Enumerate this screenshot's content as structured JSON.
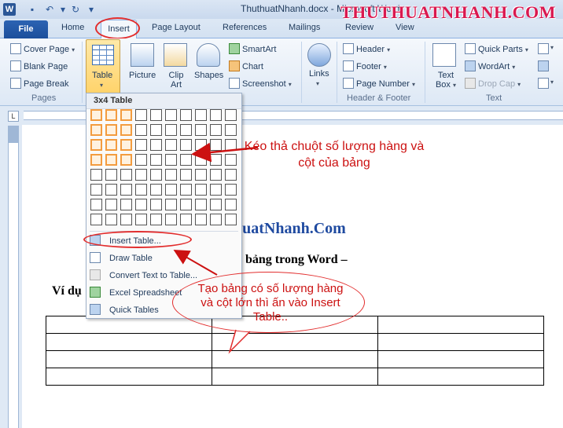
{
  "window": {
    "title": "ThuthuatNhanh.docx - Microsoft Word",
    "app_letter": "W",
    "watermark": "THUTHUATNHANH.COM"
  },
  "tabs": [
    "File",
    "Home",
    "Insert",
    "Page Layout",
    "References",
    "Mailings",
    "Review",
    "View"
  ],
  "ribbon": {
    "pages": {
      "label": "Pages",
      "items": [
        "Cover Page",
        "Blank Page",
        "Page Break"
      ]
    },
    "tables": {
      "label": "Table"
    },
    "illustrations": {
      "picture": "Picture",
      "clip_art": "Clip Art",
      "shapes": "Shapes",
      "smartart": "SmartArt",
      "chart": "Chart",
      "screenshot": "Screenshot"
    },
    "links": {
      "label": "Links"
    },
    "header_footer": {
      "label": "Header & Footer",
      "items": [
        "Header",
        "Footer",
        "Page Number"
      ]
    },
    "text": {
      "label": "Text",
      "text_box": "Text Box",
      "items": [
        "Quick Parts",
        "WordArt",
        "Drop Cap"
      ]
    }
  },
  "table_menu": {
    "title": "3x4 Table",
    "grid": {
      "columns": 10,
      "rows": 8,
      "selected_columns": 3,
      "selected_rows": 4
    },
    "items": [
      "Insert Table...",
      "Draw Table",
      "Convert Text to Table...",
      "Excel Spreadsheet",
      "Quick Tables"
    ]
  },
  "document": {
    "brand_text": "huatNhanh.Com",
    "heading_text": "o bảng trong Word –",
    "example_text": "Ví dụ",
    "table": {
      "rows": 4,
      "columns": 3
    }
  },
  "annotations": {
    "drag_note": "Kéo thả chuột số lượng hàng và cột của bảng",
    "insert_note": "Tạo bảng có số lượng hàng và cột lớn thì ấn vào Insert Table.."
  },
  "colors": {
    "accent": "#e22d2d",
    "annotation_text": "#cc1111",
    "selection": "#f39c3f",
    "file_tab": "#2c63b3"
  }
}
